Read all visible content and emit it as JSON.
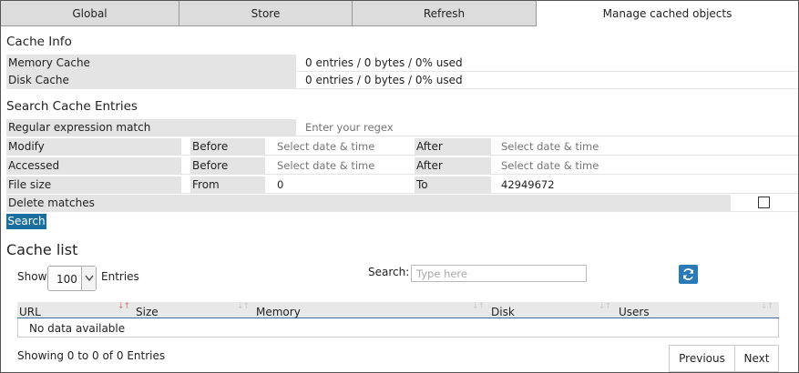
{
  "tabs": [
    {
      "label": "Global"
    },
    {
      "label": "Store"
    },
    {
      "label": "Refresh"
    },
    {
      "label": "Manage cached objects",
      "active": true
    }
  ],
  "cache_info": {
    "title": "Cache Info",
    "rows": [
      {
        "label": "Memory Cache",
        "value": "0 entries / 0 bytes / 0% used"
      },
      {
        "label": "Disk Cache",
        "value": "0 entries / 0 bytes / 0% used"
      }
    ]
  },
  "search_entries": {
    "title": "Search Cache Entries",
    "regex": {
      "label": "Regular expression match",
      "placeholder": "Enter your regex"
    },
    "modify": {
      "label": "Modify",
      "before_label": "Before",
      "before_placeholder": "Select date & time",
      "after_label": "After",
      "after_placeholder": "Select date & time"
    },
    "accessed": {
      "label": "Accessed",
      "before_label": "Before",
      "before_placeholder": "Select date & time",
      "after_label": "After",
      "after_placeholder": "Select date & time"
    },
    "file_size": {
      "label": "File size",
      "from_label": "From",
      "from_value": "0",
      "to_label": "To",
      "to_value": "42949672"
    },
    "delete_matches": {
      "label": "Delete matches",
      "checked": false
    },
    "search_button": "Search"
  },
  "cache_list": {
    "title": "Cache list",
    "show_label": "Show",
    "page_size": "100",
    "entries_label": "Entries",
    "search_label": "Search:",
    "search_placeholder": "Type here",
    "refresh_icon": "refresh-icon",
    "columns": [
      "URL",
      "Size",
      "Memory",
      "Disk",
      "Users"
    ],
    "empty_text": "No data available",
    "info_text": "Showing 0 to 0 of 0 Entries",
    "prev_label": "Previous",
    "next_label": "Next"
  },
  "colors": {
    "accent": "#1a6f9f",
    "refresh_button": "#2a7ab8",
    "label_bg": "#e4e4e4",
    "tab_bg": "#dcdcdc"
  }
}
